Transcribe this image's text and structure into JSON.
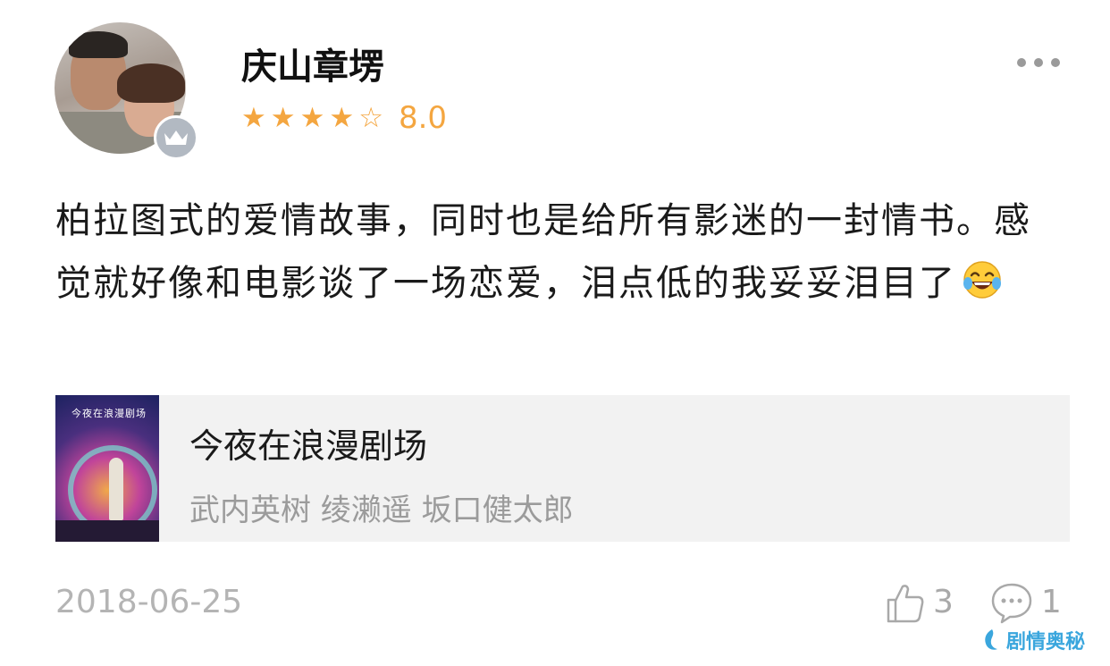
{
  "user": {
    "name": "庆山章塄",
    "avatar_icon": "user-avatar-photo",
    "badge_icon": "crown-icon"
  },
  "rating": {
    "stars_filled": 4,
    "stars_total": 5,
    "star_filled": "★",
    "star_empty": "☆",
    "score": "8.0",
    "color": "#f4a640"
  },
  "menu": {
    "icon": "more-dots-icon"
  },
  "review": {
    "text": "柏拉图式的爱情故事，同时也是给所有影迷的一封情书。感觉就好像和电影谈了一场恋爱，泪点低的我妥妥泪目了",
    "emoji": "laughing-with-tears-emoji"
  },
  "movie": {
    "title": "今夜在浪漫剧场",
    "cast": "武内英树 绫濑遥 坂口健太郎",
    "poster_title": "今夜在浪漫剧场",
    "poster_icon": "movie-poster"
  },
  "meta": {
    "date": "2018-06-25",
    "likes": "3",
    "comments": "1"
  },
  "watermark": {
    "text": "剧情奥秘",
    "icon": "watermark-logo-icon",
    "color": "#3aa6dd"
  }
}
